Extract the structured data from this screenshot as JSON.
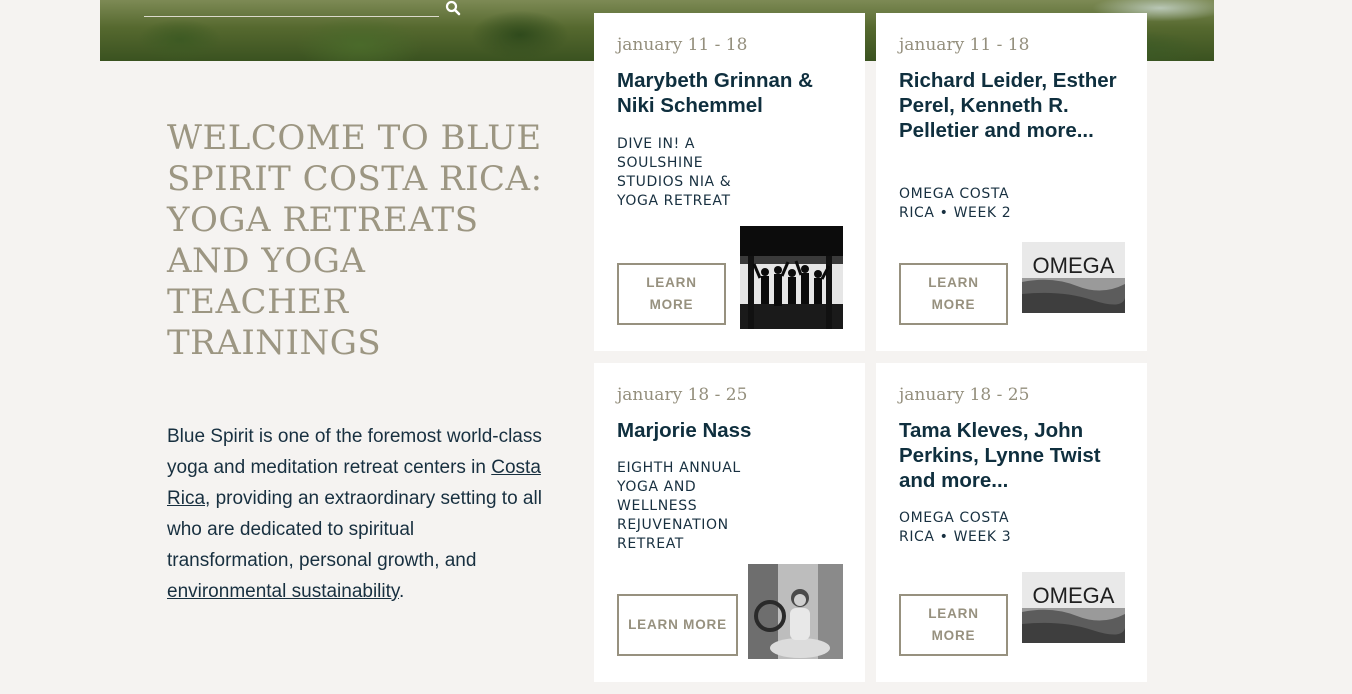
{
  "welcome": {
    "title": "WELCOME TO BLUE SPIRIT COSTA RICA: YOGA RETREATS AND YOGA TEACHER TRAININGS",
    "intro_before": "Blue Spirit is one of the foremost world-class yoga and meditation retreat centers in ",
    "intro_link1": "Costa Rica",
    "intro_middle": ", providing an extraordinary setting to all who are dedicated to spiritual transformation, personal growth, and ",
    "intro_link2": "environmental sustainability",
    "intro_after": "."
  },
  "cards": [
    {
      "date": "january 11 - 18",
      "name": "Marybeth Grinnan & Niki Schemmel",
      "subtitle": "DIVE IN! A SOULSHINE STUDIOS NIA & YOGA RETREAT",
      "button": "LEARN MORE",
      "image": "silhouette-dancers"
    },
    {
      "date": "january 11 - 18",
      "name": "Richard Leider, Esther Perel, Kenneth R. Pelletier and more...",
      "subtitle": "OMEGA COSTA RICA • WEEK 2",
      "button": "LEARN MORE",
      "image": "omega-logo",
      "logo_text": "OMEGA"
    },
    {
      "date": "january 18 - 25",
      "name": "Marjorie Nass",
      "subtitle": "EIGHTH ANNUAL YOGA AND WELLNESS REJUVENATION RETREAT",
      "button": "LEARN MORE",
      "image": "seated-teacher"
    },
    {
      "date": "january 18 - 25",
      "name": "Tama Kleves, John Perkins, Lynne Twist and more...",
      "subtitle": "OMEGA COSTA RICA • WEEK 3",
      "button": "LEARN MORE",
      "image": "omega-logo",
      "logo_text": "OMEGA"
    }
  ]
}
